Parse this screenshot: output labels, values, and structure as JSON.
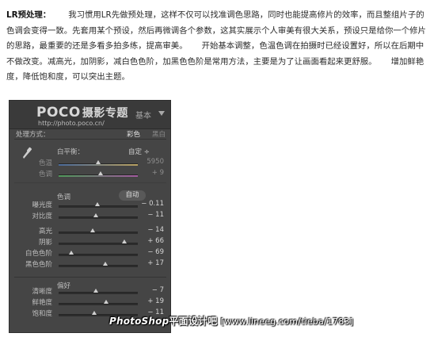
{
  "article": {
    "title": "LR预处理：",
    "para1": "我习惯用LR先做预处理，这样不仅可以找准调色思路，同时也能提高修片的效率，而且整组片子的色调会变得一致。先套用某个预设，然后再微调各个参数，这其实展示个人审美有很大关系，预设只是给你一个修片的思路，最重要的还是多看多拍多练，提高审美。",
    "para2": "开始基本调整，色温色调在拍摄时已经设置好，所以在后期中不做改变。减高光，加阴影，减白色色阶，加黑色色阶是常用方法，主要是为了让画面看起来更舒服。",
    "para3": "增加鲜艳度，降低饱和度，可以突出主题。"
  },
  "panel": {
    "logo": "POCO",
    "logo_cn": "摄影专题",
    "url": "http://photo.poco.cn/",
    "title": "基本",
    "treatment_label": "处理方式：",
    "treatment_color": "彩色",
    "treatment_bw": "黑白",
    "wb_label": "白平衡：",
    "wb_value": "自定 ÷",
    "tone_label": "色调",
    "auto_label": "自动",
    "presence_label": "偏好",
    "sliders": [
      {
        "label": "色温",
        "value": "5950",
        "level": 0.5,
        "dim": true
      },
      {
        "label": "色调",
        "value": "+ 9",
        "level": 0.53,
        "dim": true
      },
      {
        "label": "曝光度",
        "value": "− 0.11",
        "level": 0.49
      },
      {
        "label": "对比度",
        "value": "− 11",
        "level": 0.47
      },
      {
        "label": "高光",
        "value": "− 14",
        "level": 0.43
      },
      {
        "label": "阴影",
        "value": "+ 66",
        "level": 0.83
      },
      {
        "label": "白色色阶",
        "value": "− 69",
        "level": 0.16
      },
      {
        "label": "黑色色阶",
        "value": "+ 17",
        "level": 0.59
      },
      {
        "label": "清晰度",
        "value": "− 7",
        "level": 0.47
      },
      {
        "label": "鲜艳度",
        "value": "+ 19",
        "level": 0.6
      },
      {
        "label": "饱和度",
        "value": "− 11",
        "level": 0.45
      }
    ]
  },
  "watermark": {
    "ps": "PhotoShop",
    "site": "平面设计吧",
    "url": "[www.lineeg.com/tieba/1783]"
  },
  "colors": {
    "panel_bg": "#454545",
    "header_bg": "#3a3a3a",
    "text": "#2b2b2b"
  }
}
